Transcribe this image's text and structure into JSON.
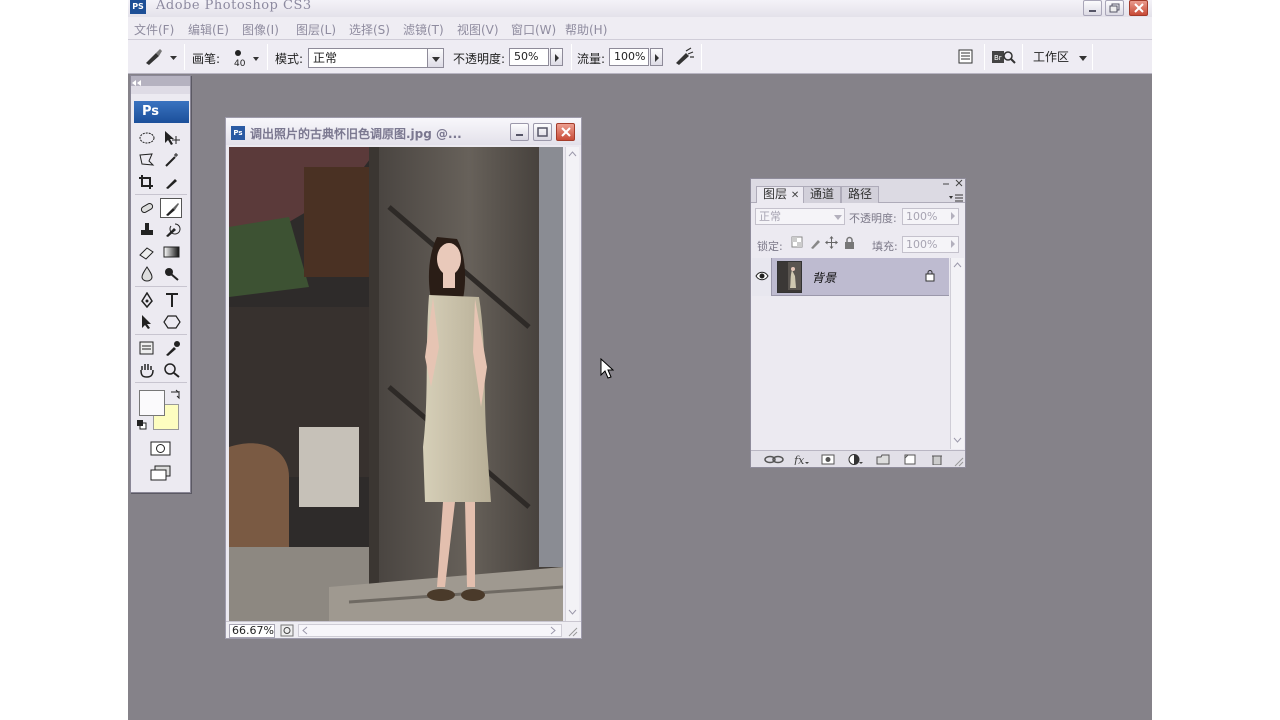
{
  "app": {
    "title": "Adobe Photoshop CS3",
    "icon_text": "PS"
  },
  "menubar": {
    "items": [
      "文件(F)",
      "编辑(E)",
      "图像(I)",
      "图层(L)",
      "选择(S)",
      "滤镜(T)",
      "视图(V)",
      "窗口(W)",
      "帮助(H)"
    ]
  },
  "options": {
    "brush_label": "画笔:",
    "brush_size": "40",
    "mode_label": "模式:",
    "mode_value": "正常",
    "opacity_label": "不透明度:",
    "opacity_value": "50%",
    "flow_label": "流量:",
    "flow_value": "100%",
    "workspace_label": "工作区"
  },
  "toolbox": {
    "logo": "Ps",
    "foreground_color": "#fbfafc",
    "background_color": "#fdfdc0"
  },
  "document": {
    "icon_text": "Ps",
    "title": "调出照片的古典怀旧色调原图.jpg @...",
    "zoom": "66.67%"
  },
  "layers_panel": {
    "tabs": [
      "图层",
      "通道",
      "路径"
    ],
    "blend_mode": "正常",
    "opacity_label": "不透明度:",
    "opacity_value": "100%",
    "lock_label": "锁定:",
    "fill_label": "填充:",
    "fill_value": "100%",
    "layers": [
      {
        "name": "背景",
        "visible": true,
        "locked": true
      }
    ]
  },
  "colors": {
    "workspace_bg": "#858289",
    "panel_bg": "#eceaf1",
    "selected_layer": "#bebbd0"
  }
}
